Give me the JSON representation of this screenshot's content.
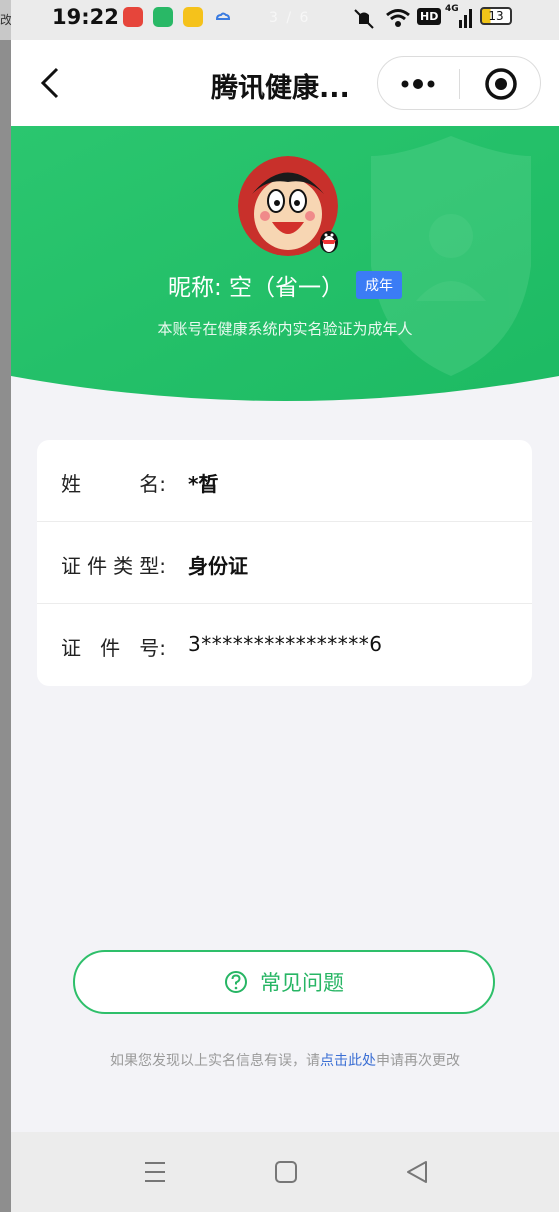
{
  "status_bar": {
    "time": "19:22",
    "page_indicator": "3 / 6",
    "battery": "13",
    "network": "4G",
    "hd": "HD"
  },
  "left_strip_text": "改",
  "nav": {
    "title": "腾讯健康..."
  },
  "profile": {
    "nickname_label": "昵称: 空（省一）",
    "badge": "成年",
    "verify_text": "本账号在健康系统内实名验证为成年人"
  },
  "info": {
    "rows": [
      {
        "label": "姓名:",
        "label_chars": [
          "姓",
          "名:"
        ],
        "value": "*晳"
      },
      {
        "label": "证件类型:",
        "label_chars": [
          "证",
          "件",
          "类",
          "型:"
        ],
        "value": "身份证"
      },
      {
        "label": "证件号:",
        "label_chars": [
          "证",
          "件",
          "号:"
        ],
        "value": "3****************6"
      }
    ]
  },
  "faq": {
    "label": "常见问题"
  },
  "footnote": {
    "prefix": "如果您发现以上实名信息有误，请",
    "link": "点击此处",
    "suffix": "申请再次更改"
  },
  "colors": {
    "green": "#2ebf6a",
    "badge_blue": "#3b7cf5",
    "link_blue": "#3b6fd4"
  },
  "icons": [
    "back-icon",
    "more-icon",
    "close-target-icon",
    "question-icon",
    "menu-icon",
    "home-icon",
    "back-triangle-icon",
    "qq-penguin-icon",
    "shield-icon"
  ]
}
